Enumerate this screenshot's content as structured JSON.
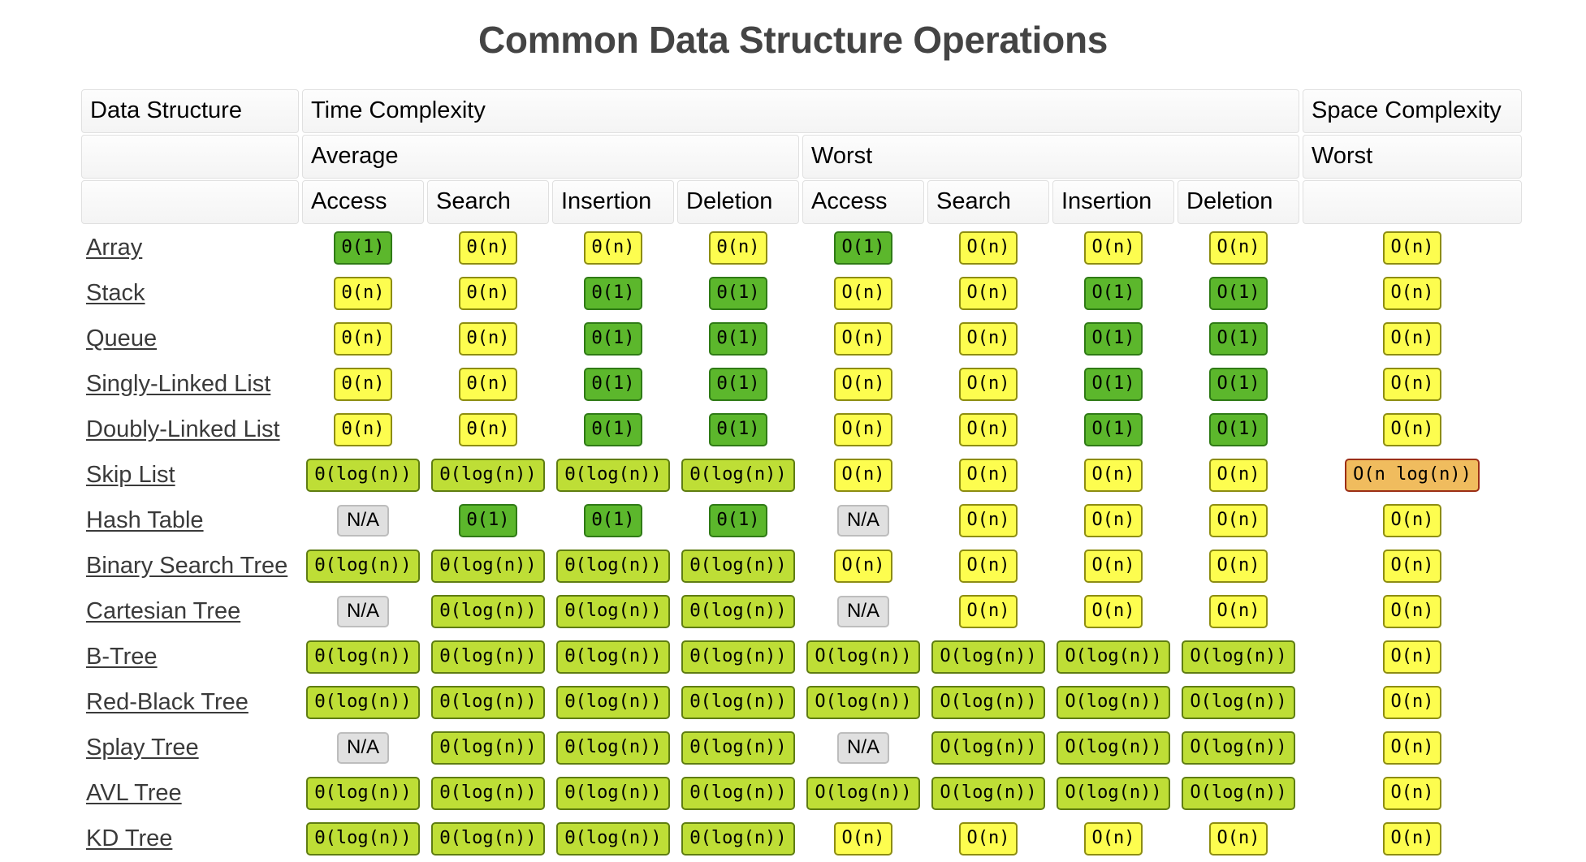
{
  "title": "Common Data Structure Operations",
  "header": {
    "row1": {
      "data_structure": "Data Structure",
      "time_complexity": "Time Complexity",
      "space_complexity": "Space Complexity"
    },
    "row2": {
      "average": "Average",
      "worst": "Worst",
      "space_worst": "Worst"
    },
    "row3": {
      "avg_access": "Access",
      "avg_search": "Search",
      "avg_insertion": "Insertion",
      "avg_deletion": "Deletion",
      "worst_access": "Access",
      "worst_search": "Search",
      "worst_insertion": "Insertion",
      "worst_deletion": "Deletion"
    }
  },
  "colors": {
    "green": "#5cb72c",
    "yellow_green": "#bede36",
    "yellow": "#fdfd4f",
    "orange": "#f0bc5e",
    "na_gray": "#e0e0e0",
    "title": "#444444",
    "link": "#3a3a3a"
  },
  "rows": [
    {
      "name": "Array",
      "cells": [
        {
          "text": "Θ(1)",
          "color": "green"
        },
        {
          "text": "Θ(n)",
          "color": "yellow"
        },
        {
          "text": "Θ(n)",
          "color": "yellow"
        },
        {
          "text": "Θ(n)",
          "color": "yellow"
        },
        {
          "text": "O(1)",
          "color": "green"
        },
        {
          "text": "O(n)",
          "color": "yellow"
        },
        {
          "text": "O(n)",
          "color": "yellow"
        },
        {
          "text": "O(n)",
          "color": "yellow"
        },
        {
          "text": "O(n)",
          "color": "yellow"
        }
      ]
    },
    {
      "name": "Stack",
      "cells": [
        {
          "text": "Θ(n)",
          "color": "yellow"
        },
        {
          "text": "Θ(n)",
          "color": "yellow"
        },
        {
          "text": "Θ(1)",
          "color": "green"
        },
        {
          "text": "Θ(1)",
          "color": "green"
        },
        {
          "text": "O(n)",
          "color": "yellow"
        },
        {
          "text": "O(n)",
          "color": "yellow"
        },
        {
          "text": "O(1)",
          "color": "green"
        },
        {
          "text": "O(1)",
          "color": "green"
        },
        {
          "text": "O(n)",
          "color": "yellow"
        }
      ]
    },
    {
      "name": "Queue",
      "cells": [
        {
          "text": "Θ(n)",
          "color": "yellow"
        },
        {
          "text": "Θ(n)",
          "color": "yellow"
        },
        {
          "text": "Θ(1)",
          "color": "green"
        },
        {
          "text": "Θ(1)",
          "color": "green"
        },
        {
          "text": "O(n)",
          "color": "yellow"
        },
        {
          "text": "O(n)",
          "color": "yellow"
        },
        {
          "text": "O(1)",
          "color": "green"
        },
        {
          "text": "O(1)",
          "color": "green"
        },
        {
          "text": "O(n)",
          "color": "yellow"
        }
      ]
    },
    {
      "name": "Singly-Linked List",
      "cells": [
        {
          "text": "Θ(n)",
          "color": "yellow"
        },
        {
          "text": "Θ(n)",
          "color": "yellow"
        },
        {
          "text": "Θ(1)",
          "color": "green"
        },
        {
          "text": "Θ(1)",
          "color": "green"
        },
        {
          "text": "O(n)",
          "color": "yellow"
        },
        {
          "text": "O(n)",
          "color": "yellow"
        },
        {
          "text": "O(1)",
          "color": "green"
        },
        {
          "text": "O(1)",
          "color": "green"
        },
        {
          "text": "O(n)",
          "color": "yellow"
        }
      ]
    },
    {
      "name": "Doubly-Linked List",
      "cells": [
        {
          "text": "Θ(n)",
          "color": "yellow"
        },
        {
          "text": "Θ(n)",
          "color": "yellow"
        },
        {
          "text": "Θ(1)",
          "color": "green"
        },
        {
          "text": "Θ(1)",
          "color": "green"
        },
        {
          "text": "O(n)",
          "color": "yellow"
        },
        {
          "text": "O(n)",
          "color": "yellow"
        },
        {
          "text": "O(1)",
          "color": "green"
        },
        {
          "text": "O(1)",
          "color": "green"
        },
        {
          "text": "O(n)",
          "color": "yellow"
        }
      ]
    },
    {
      "name": "Skip List",
      "cells": [
        {
          "text": "Θ(log(n))",
          "color": "yellow_green"
        },
        {
          "text": "Θ(log(n))",
          "color": "yellow_green"
        },
        {
          "text": "Θ(log(n))",
          "color": "yellow_green"
        },
        {
          "text": "Θ(log(n))",
          "color": "yellow_green"
        },
        {
          "text": "O(n)",
          "color": "yellow"
        },
        {
          "text": "O(n)",
          "color": "yellow"
        },
        {
          "text": "O(n)",
          "color": "yellow"
        },
        {
          "text": "O(n)",
          "color": "yellow"
        },
        {
          "text": "O(n log(n))",
          "color": "orange"
        }
      ]
    },
    {
      "name": "Hash Table",
      "cells": [
        {
          "text": "N/A",
          "color": "na"
        },
        {
          "text": "Θ(1)",
          "color": "green"
        },
        {
          "text": "Θ(1)",
          "color": "green"
        },
        {
          "text": "Θ(1)",
          "color": "green"
        },
        {
          "text": "N/A",
          "color": "na"
        },
        {
          "text": "O(n)",
          "color": "yellow"
        },
        {
          "text": "O(n)",
          "color": "yellow"
        },
        {
          "text": "O(n)",
          "color": "yellow"
        },
        {
          "text": "O(n)",
          "color": "yellow"
        }
      ]
    },
    {
      "name": "Binary Search Tree",
      "cells": [
        {
          "text": "Θ(log(n))",
          "color": "yellow_green"
        },
        {
          "text": "Θ(log(n))",
          "color": "yellow_green"
        },
        {
          "text": "Θ(log(n))",
          "color": "yellow_green"
        },
        {
          "text": "Θ(log(n))",
          "color": "yellow_green"
        },
        {
          "text": "O(n)",
          "color": "yellow"
        },
        {
          "text": "O(n)",
          "color": "yellow"
        },
        {
          "text": "O(n)",
          "color": "yellow"
        },
        {
          "text": "O(n)",
          "color": "yellow"
        },
        {
          "text": "O(n)",
          "color": "yellow"
        }
      ]
    },
    {
      "name": "Cartesian Tree",
      "cells": [
        {
          "text": "N/A",
          "color": "na"
        },
        {
          "text": "Θ(log(n))",
          "color": "yellow_green"
        },
        {
          "text": "Θ(log(n))",
          "color": "yellow_green"
        },
        {
          "text": "Θ(log(n))",
          "color": "yellow_green"
        },
        {
          "text": "N/A",
          "color": "na"
        },
        {
          "text": "O(n)",
          "color": "yellow"
        },
        {
          "text": "O(n)",
          "color": "yellow"
        },
        {
          "text": "O(n)",
          "color": "yellow"
        },
        {
          "text": "O(n)",
          "color": "yellow"
        }
      ]
    },
    {
      "name": "B-Tree",
      "cells": [
        {
          "text": "Θ(log(n))",
          "color": "yellow_green"
        },
        {
          "text": "Θ(log(n))",
          "color": "yellow_green"
        },
        {
          "text": "Θ(log(n))",
          "color": "yellow_green"
        },
        {
          "text": "Θ(log(n))",
          "color": "yellow_green"
        },
        {
          "text": "O(log(n))",
          "color": "yellow_green"
        },
        {
          "text": "O(log(n))",
          "color": "yellow_green"
        },
        {
          "text": "O(log(n))",
          "color": "yellow_green"
        },
        {
          "text": "O(log(n))",
          "color": "yellow_green"
        },
        {
          "text": "O(n)",
          "color": "yellow"
        }
      ]
    },
    {
      "name": "Red-Black Tree",
      "cells": [
        {
          "text": "Θ(log(n))",
          "color": "yellow_green"
        },
        {
          "text": "Θ(log(n))",
          "color": "yellow_green"
        },
        {
          "text": "Θ(log(n))",
          "color": "yellow_green"
        },
        {
          "text": "Θ(log(n))",
          "color": "yellow_green"
        },
        {
          "text": "O(log(n))",
          "color": "yellow_green"
        },
        {
          "text": "O(log(n))",
          "color": "yellow_green"
        },
        {
          "text": "O(log(n))",
          "color": "yellow_green"
        },
        {
          "text": "O(log(n))",
          "color": "yellow_green"
        },
        {
          "text": "O(n)",
          "color": "yellow"
        }
      ]
    },
    {
      "name": "Splay Tree",
      "cells": [
        {
          "text": "N/A",
          "color": "na"
        },
        {
          "text": "Θ(log(n))",
          "color": "yellow_green"
        },
        {
          "text": "Θ(log(n))",
          "color": "yellow_green"
        },
        {
          "text": "Θ(log(n))",
          "color": "yellow_green"
        },
        {
          "text": "N/A",
          "color": "na"
        },
        {
          "text": "O(log(n))",
          "color": "yellow_green"
        },
        {
          "text": "O(log(n))",
          "color": "yellow_green"
        },
        {
          "text": "O(log(n))",
          "color": "yellow_green"
        },
        {
          "text": "O(n)",
          "color": "yellow"
        }
      ]
    },
    {
      "name": "AVL Tree",
      "cells": [
        {
          "text": "Θ(log(n))",
          "color": "yellow_green"
        },
        {
          "text": "Θ(log(n))",
          "color": "yellow_green"
        },
        {
          "text": "Θ(log(n))",
          "color": "yellow_green"
        },
        {
          "text": "Θ(log(n))",
          "color": "yellow_green"
        },
        {
          "text": "O(log(n))",
          "color": "yellow_green"
        },
        {
          "text": "O(log(n))",
          "color": "yellow_green"
        },
        {
          "text": "O(log(n))",
          "color": "yellow_green"
        },
        {
          "text": "O(log(n))",
          "color": "yellow_green"
        },
        {
          "text": "O(n)",
          "color": "yellow"
        }
      ]
    },
    {
      "name": "KD Tree",
      "cells": [
        {
          "text": "Θ(log(n))",
          "color": "yellow_green"
        },
        {
          "text": "Θ(log(n))",
          "color": "yellow_green"
        },
        {
          "text": "Θ(log(n))",
          "color": "yellow_green"
        },
        {
          "text": "Θ(log(n))",
          "color": "yellow_green"
        },
        {
          "text": "O(n)",
          "color": "yellow"
        },
        {
          "text": "O(n)",
          "color": "yellow"
        },
        {
          "text": "O(n)",
          "color": "yellow"
        },
        {
          "text": "O(n)",
          "color": "yellow"
        },
        {
          "text": "O(n)",
          "color": "yellow"
        }
      ]
    }
  ]
}
